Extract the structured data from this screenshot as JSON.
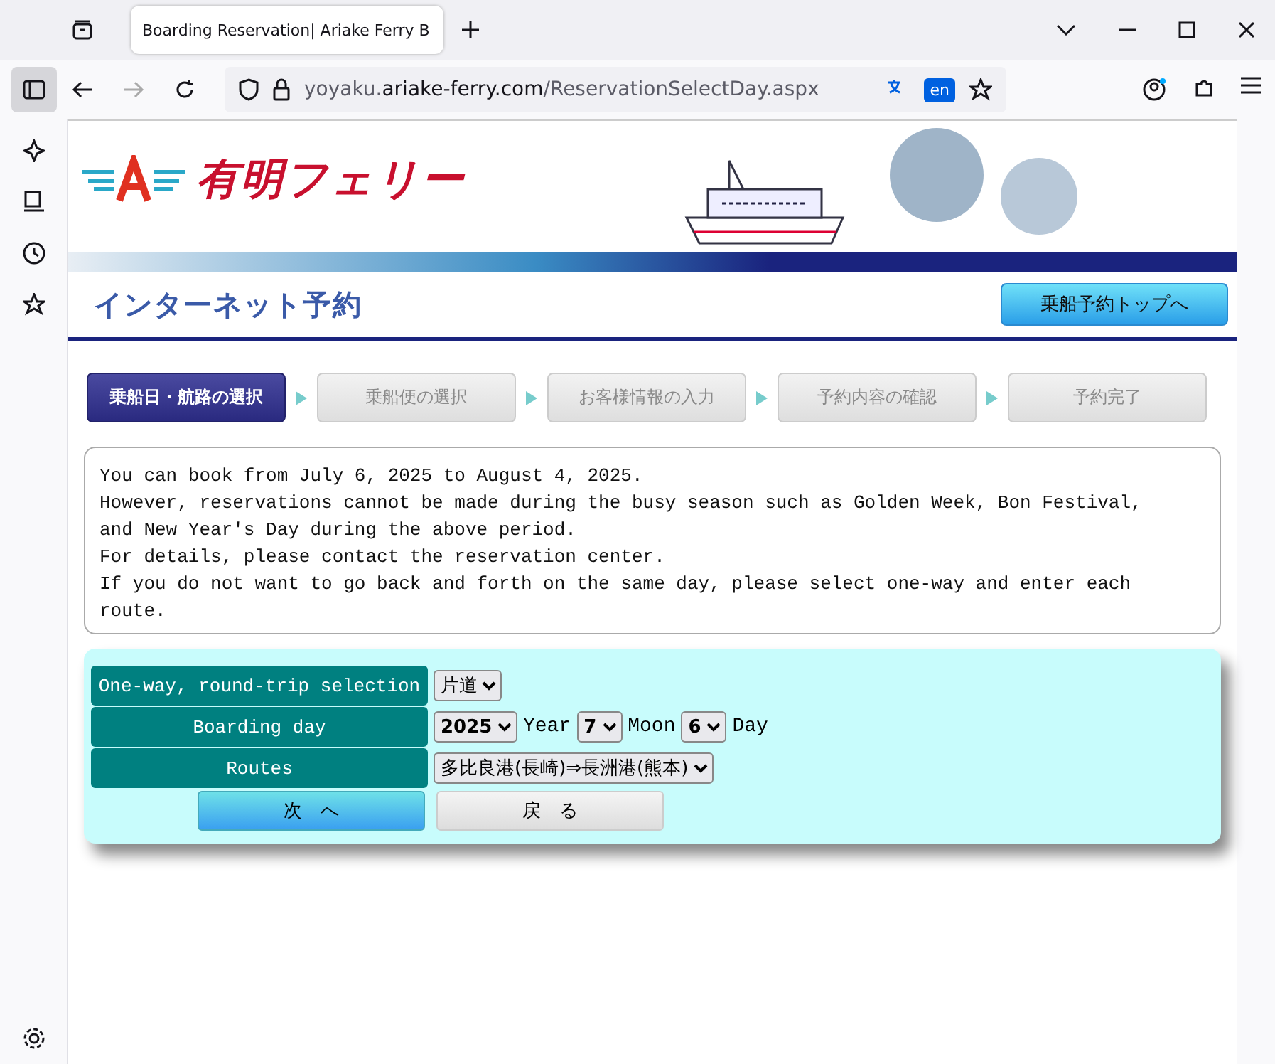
{
  "browser": {
    "tab_title": "Boarding Reservation| Ariake Ferry B",
    "url_prefix": "yoyaku.",
    "url_domain": "ariake-ferry.com",
    "url_path": "/ReservationSelectDay.aspx",
    "translate_badge": "en"
  },
  "header": {
    "logo_text": "有明フェリー",
    "subtitle": "インターネット予約",
    "top_button": "乗船予約トップへ"
  },
  "steps": [
    {
      "label": "乗船日・航路の選択",
      "selected": true
    },
    {
      "label": "乗船便の選択",
      "selected": false
    },
    {
      "label": "お客様情報の入力",
      "selected": false
    },
    {
      "label": "予約内容の確認",
      "selected": false
    },
    {
      "label": "予約完了",
      "selected": false
    }
  ],
  "notice": [
    "You can book from July 6, 2025 to August 4, 2025.",
    "However, reservations cannot be made during the busy season such as Golden Week, Bon Festival, and New Year's Day during the above period.",
    "For details, please contact the reservation center.",
    "If you do not want to go back and forth on the same day, please select one-way and enter each route."
  ],
  "form": {
    "rows": [
      {
        "label": "One-way, round-trip selection",
        "fields": [
          {
            "kind": "select",
            "value": "片道"
          }
        ]
      },
      {
        "label": "Boarding day",
        "fields": [
          {
            "kind": "select",
            "value": "2025",
            "bold": true
          },
          {
            "kind": "text",
            "value": "Year"
          },
          {
            "kind": "select",
            "value": "7",
            "bold": true
          },
          {
            "kind": "text",
            "value": "Moon"
          },
          {
            "kind": "select",
            "value": "6",
            "bold": true
          },
          {
            "kind": "text",
            "value": "Day"
          }
        ]
      },
      {
        "label": "Routes",
        "fields": [
          {
            "kind": "select",
            "value": "多比良港(長崎)⇒長洲港(熊本)"
          }
        ]
      }
    ],
    "next_button": "次　へ",
    "back_button": "戻　る"
  }
}
